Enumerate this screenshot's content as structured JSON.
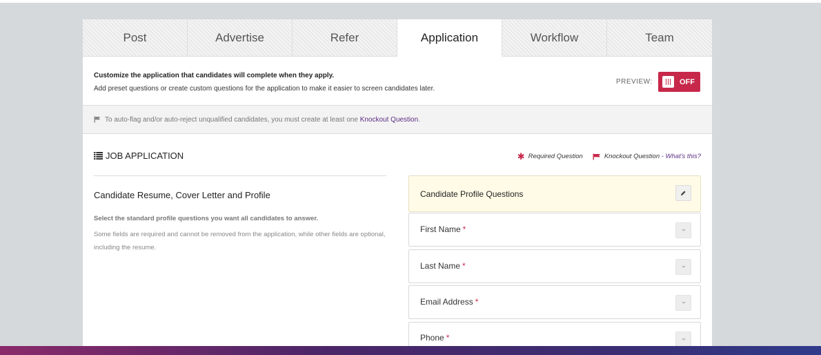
{
  "tabs": [
    {
      "label": "Post",
      "active": false
    },
    {
      "label": "Advertise",
      "active": false
    },
    {
      "label": "Refer",
      "active": false
    },
    {
      "label": "Application",
      "active": true
    },
    {
      "label": "Workflow",
      "active": false
    },
    {
      "label": "Team",
      "active": false
    }
  ],
  "intro": {
    "title": "Customize the application that candidates will complete when they apply.",
    "subtitle": "Add preset questions or create custom questions for the application to make it easier to screen candidates later."
  },
  "preview": {
    "label": "PREVIEW:",
    "toggle_state": "OFF"
  },
  "notice": {
    "text": "To auto-flag and/or auto-reject unqualified candidates, you must create at least one",
    "link": "Knockout Question",
    "suffix": "."
  },
  "job_application": {
    "title": "JOB APPLICATION"
  },
  "legend": {
    "required": "Required Question",
    "knockout": "Knockout Question",
    "whats_this": "- What's this?"
  },
  "section": {
    "title": "Candidate Resume, Cover Letter and Profile",
    "bold_text": "Select the standard profile questions you want all candidates to answer.",
    "description": "Some fields are required and cannot be removed from the application, while other fields are optional, including the resume."
  },
  "questions_header": "Candidate Profile Questions",
  "questions": [
    {
      "label": "First Name",
      "required_marker": "*"
    },
    {
      "label": "Last Name",
      "required_marker": "*"
    },
    {
      "label": "Email Address",
      "required_marker": "*"
    },
    {
      "label": "Phone",
      "required_marker": "*"
    }
  ],
  "colors": {
    "accent_red": "#c7284a",
    "link_purple": "#5b2d82",
    "header_card_bg": "#fffbe6"
  },
  "icons": {
    "toggle_knob": "grip-icon",
    "notice": "flag-icon",
    "job_application": "list-icon",
    "required": "asterisk-icon",
    "knockout": "flag-icon",
    "edit": "pencil-icon",
    "expand": "caret-down-icon"
  }
}
